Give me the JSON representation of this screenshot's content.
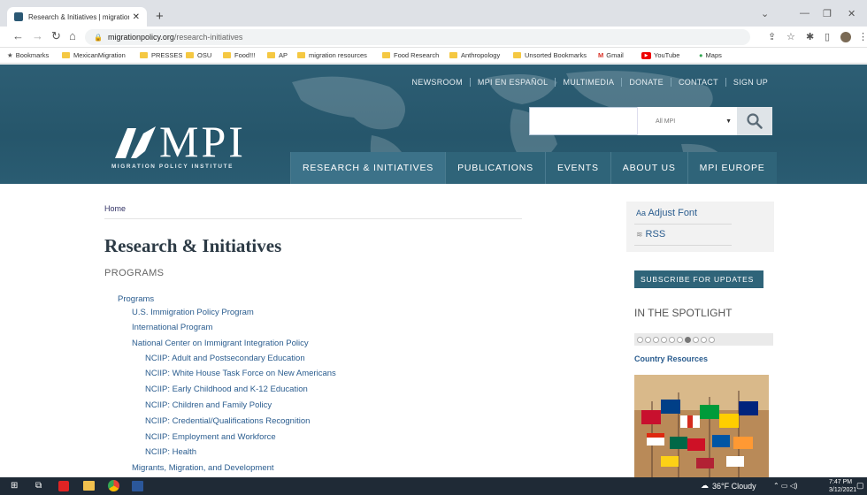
{
  "browser": {
    "tab_title": "Research & Initiatives | migration",
    "new_tab": "+",
    "url_host": "migrationpolicy.org",
    "url_path": "/research-initiatives",
    "bookmarks": [
      {
        "label": "Bookmarks",
        "kind": "star"
      },
      {
        "label": "MexicanMigration",
        "kind": "folder"
      },
      {
        "label": "PRESSES",
        "kind": "folder"
      },
      {
        "label": "OSU",
        "kind": "folder"
      },
      {
        "label": "Food!!!",
        "kind": "folder"
      },
      {
        "label": "AP",
        "kind": "folder"
      },
      {
        "label": "migration resources",
        "kind": "folder"
      },
      {
        "label": "Food Research",
        "kind": "folder"
      },
      {
        "label": "Anthropology",
        "kind": "folder"
      },
      {
        "label": "Unsorted Bookmarks",
        "kind": "folder"
      },
      {
        "label": "Gmail",
        "kind": "gmail"
      },
      {
        "label": "YouTube",
        "kind": "youtube"
      },
      {
        "label": "Maps",
        "kind": "maps"
      }
    ]
  },
  "header": {
    "util_nav": [
      "NEWSROOM",
      "MPI EN ESPAÑOL",
      "MULTIMEDIA",
      "DONATE",
      "CONTACT",
      "SIGN UP"
    ],
    "search_placeholder": "",
    "search_scope": "All MPI",
    "logo_word": "MPI",
    "logo_tagline": "MIGRATION POLICY INSTITUTE",
    "main_nav": [
      "RESEARCH & INITIATIVES",
      "PUBLICATIONS",
      "EVENTS",
      "ABOUT US",
      "MPI EUROPE"
    ]
  },
  "content": {
    "breadcrumb": "Home",
    "title": "Research & Initiatives",
    "subtitle": "PROGRAMS",
    "links": [
      {
        "text": "Programs",
        "level": 0
      },
      {
        "text": "U.S. Immigration Policy Program",
        "level": 1
      },
      {
        "text": "International Program",
        "level": 1
      },
      {
        "text": "National Center on Immigrant Integration Policy",
        "level": 1
      },
      {
        "text": "NCIIP: Adult and Postsecondary Education",
        "level": 2
      },
      {
        "text": "NCIIP: White House Task Force on New Americans",
        "level": 2
      },
      {
        "text": "NCIIP: Early Childhood and K-12 Education",
        "level": 2
      },
      {
        "text": "NCIIP: Children and Family Policy",
        "level": 2
      },
      {
        "text": "NCIIP: Credential/Qualifications Recognition",
        "level": 2
      },
      {
        "text": "NCIIP: Employment and Workforce",
        "level": 2
      },
      {
        "text": "NCIIP: Health",
        "level": 2
      },
      {
        "text": "Migrants, Migration, and Development",
        "level": 1
      }
    ]
  },
  "sidebar": {
    "adjust_font_icon": "Aa",
    "adjust_font": "Adjust Font",
    "rss": "RSS",
    "subscribe": "SUBSCRIBE FOR UPDATES",
    "spotlight": "IN THE SPOTLIGHT",
    "slider_total": 10,
    "slider_active": 7,
    "country_resources": "Country Resources"
  },
  "taskbar": {
    "weather": "36°F  Cloudy",
    "time": "7:47 PM",
    "date": "3/12/2021"
  }
}
